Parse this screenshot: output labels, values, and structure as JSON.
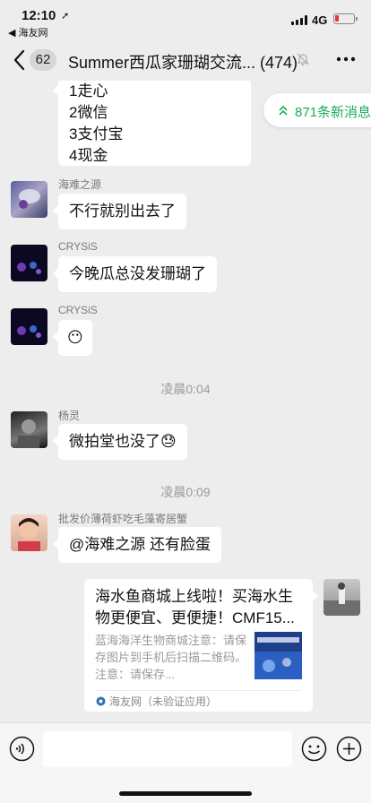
{
  "status_bar": {
    "time": "12:10",
    "back_app": "◀ 海友网",
    "network": "4G"
  },
  "nav": {
    "unread_count": "62",
    "title": "Summer西瓜家珊瑚交流... (474)"
  },
  "new_messages": "871条新消息",
  "messages": {
    "list_bubble": [
      "1走心",
      "2微信",
      "3支付宝",
      "4现金"
    ],
    "m1": {
      "sender": "海难之源",
      "text": "不行就别出去了"
    },
    "m2": {
      "sender": "CRYSiS",
      "text": "今晚瓜总没发珊瑚了"
    },
    "m3": {
      "sender": "CRYSiS",
      "text": "😶"
    },
    "time1": "凌晨0:04",
    "m4": {
      "sender": "杨灵",
      "text": "微拍堂也没了😓"
    },
    "time2": "凌晨0:09",
    "m5": {
      "sender": "批发价薄荷虾吃毛藻寄居蟹",
      "text": "@海难之源 还有脸蛋"
    },
    "link_card": {
      "title": "海水鱼商城上线啦！买海水生物更便宜、更便捷！CMF15...",
      "description": "蓝海海洋生物商城注意：请保存图片到手机后扫描二维码。注意：请保存...",
      "source": "海友网（未验证应用）"
    }
  },
  "colors": {
    "accent_green": "#1aad55",
    "background": "#ededed",
    "battery_low": "#e53935"
  },
  "icons": [
    "back-chevron-icon",
    "bell-muted-icon",
    "more-dots-icon",
    "double-chevron-up-icon",
    "voice-icon",
    "emoji-icon",
    "plus-icon"
  ]
}
